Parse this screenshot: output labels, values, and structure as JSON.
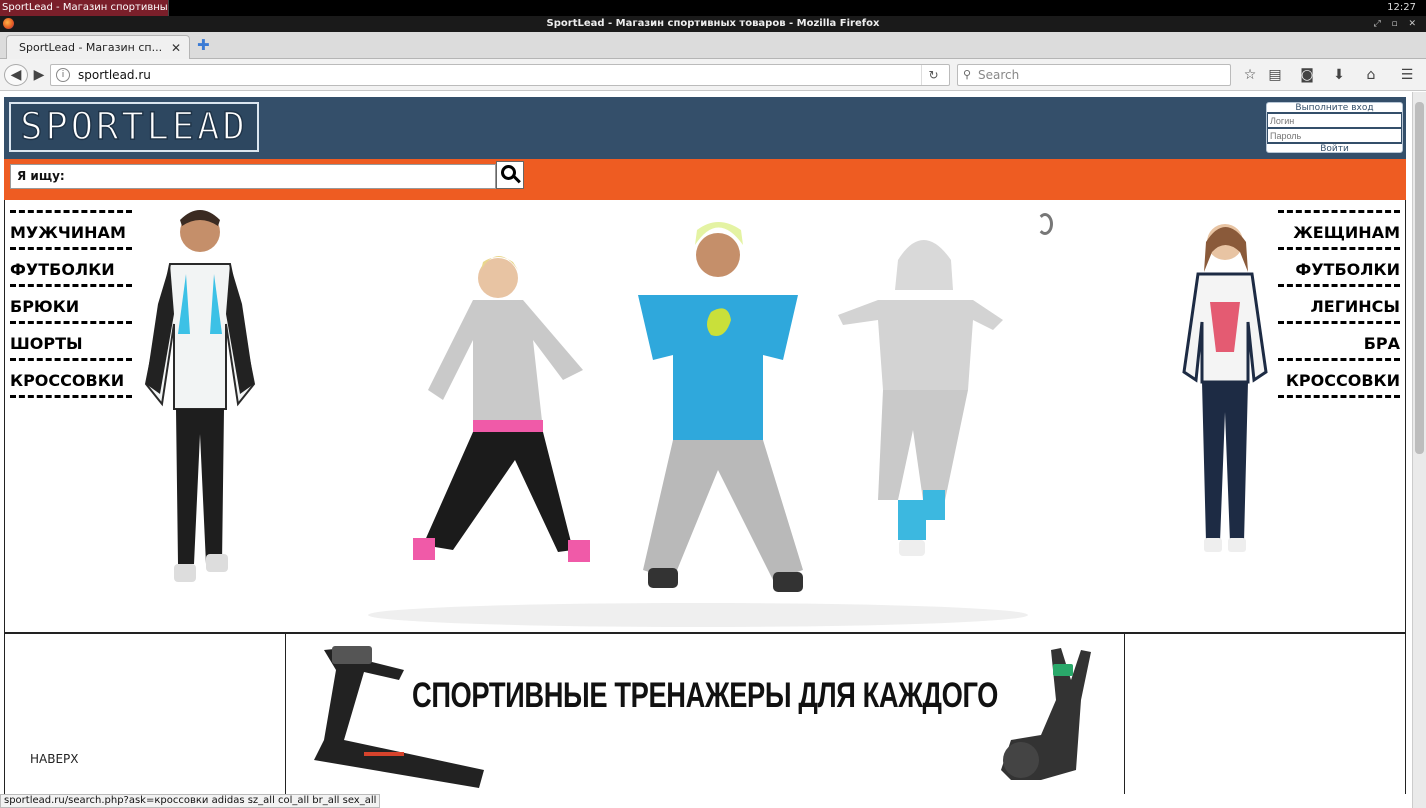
{
  "os": {
    "task_label": "SportLead - Магазин спортивны...",
    "clock": "12:27"
  },
  "window": {
    "title": "SportLead - Магазин спортивных товаров - Mozilla Firefox"
  },
  "tab": {
    "label": "SportLead - Магазин сп...",
    "close": "✕",
    "new_tab": "✚"
  },
  "navbar": {
    "url": "sportlead.ru",
    "search_placeholder": "Search",
    "icons": [
      "back-arrow-icon",
      "forward-arrow-icon",
      "reload-icon",
      "bookmark-star-icon",
      "reading-list-icon",
      "pocket-icon",
      "download-icon",
      "home-icon",
      "menu-icon"
    ]
  },
  "site": {
    "logo": "SPORTLEAD",
    "login": {
      "title": "Выполните вход",
      "login_placeholder": "Логин",
      "password_placeholder": "Пароль",
      "submit": "Войти"
    },
    "search_label": "Я ищу:",
    "men": {
      "heading": "МУЖЧИНАМ",
      "items": [
        "ФУТБОЛКИ",
        "БРЮКИ",
        "ШОРТЫ",
        "КРОССОВКИ"
      ]
    },
    "women": {
      "heading": "ЖЕЩИНАМ",
      "items": [
        "ФУТБОЛКИ",
        "ЛЕГИНСЫ",
        "БРА",
        "КРОССОВКИ"
      ]
    },
    "slider_dots": "•••",
    "banner_text": "СПОРТИВНЫЕ ТРЕНАЖЕРЫ ДЛЯ КАЖДОГО",
    "back_to_top": "НАВЕРХ"
  },
  "status_bar": "sportlead.ru/search.php?ask=кроссовки adidas sz_all col_all br_all sex_all"
}
